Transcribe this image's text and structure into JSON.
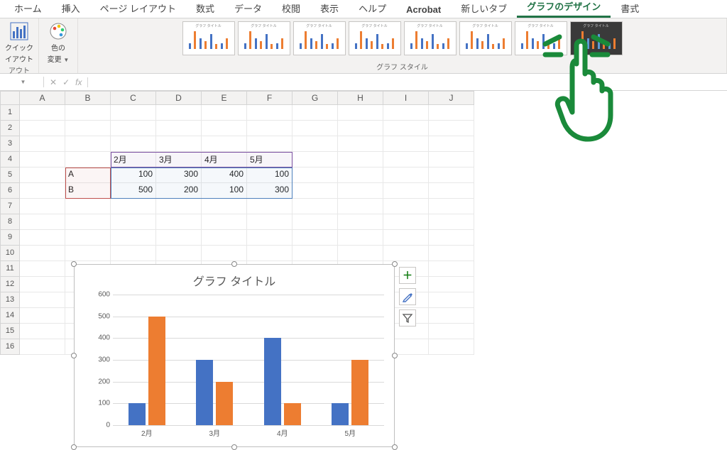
{
  "tabs": {
    "home": "ホーム",
    "insert": "挿入",
    "pageLayout": "ページ レイアウト",
    "formulas": "数式",
    "data": "データ",
    "review": "校閲",
    "view": "表示",
    "help": "ヘルプ",
    "acrobat": "Acrobat",
    "newTab": "新しいタブ",
    "chartDesign": "グラフのデザイン",
    "format": "書式"
  },
  "ribbon": {
    "quickLayout": "クイック\nレイアウト",
    "quickLayoutShort1": "クイック",
    "quickLayoutShort2": "イアウト",
    "changeColors1": "色の",
    "changeColors2": "変更",
    "groupLayout": "アウト",
    "groupChartStyles": "グラフ スタイル",
    "thumbTitle": "グラフ タイトル"
  },
  "formulaBar": {
    "nameBox": "",
    "cancel": "✕",
    "confirm": "✓",
    "fx": "fx",
    "value": ""
  },
  "columns": [
    "A",
    "B",
    "C",
    "D",
    "E",
    "F",
    "G",
    "H",
    "I",
    "J"
  ],
  "rowNumbers": [
    "1",
    "2",
    "3",
    "4",
    "5",
    "6",
    "7",
    "8",
    "9",
    "10",
    "11",
    "12",
    "13",
    "14",
    "15",
    "16"
  ],
  "tableHeadersRow": 4,
  "tableHeaders": {
    "c": "2月",
    "d": "3月",
    "e": "4月",
    "f": "5月"
  },
  "tableRows": [
    {
      "label": "A",
      "c": "100",
      "d": "300",
      "e": "400",
      "f": "100"
    },
    {
      "label": "B",
      "c": "500",
      "d": "200",
      "e": "100",
      "f": "300"
    }
  ],
  "chart": {
    "title": "グラフ タイトル",
    "yTicks": [
      "0",
      "100",
      "200",
      "300",
      "400",
      "500",
      "600"
    ],
    "xLabels": [
      "2月",
      "3月",
      "4月",
      "5月"
    ]
  },
  "chartSide": {
    "plus": "＋",
    "brush": "brush-icon",
    "filter": "filter-icon"
  },
  "chart_data": {
    "type": "bar",
    "title": "グラフ タイトル",
    "categories": [
      "2月",
      "3月",
      "4月",
      "5月"
    ],
    "series": [
      {
        "name": "A",
        "values": [
          100,
          300,
          400,
          100
        ],
        "color": "#4472c4"
      },
      {
        "name": "B",
        "values": [
          500,
          200,
          100,
          300
        ],
        "color": "#ed7d31"
      }
    ],
    "ylim": [
      0,
      600
    ],
    "ylabel": "",
    "xlabel": ""
  }
}
